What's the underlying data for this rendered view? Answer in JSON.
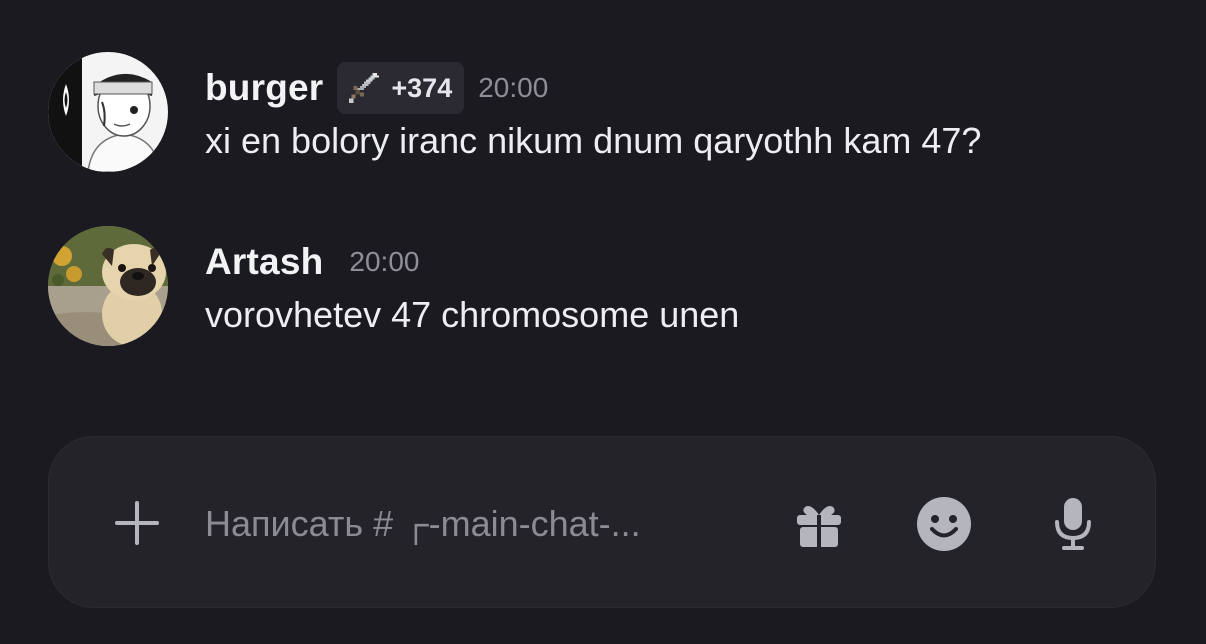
{
  "messages": [
    {
      "username": "burger",
      "badge": "+374",
      "badge_icon": "sword-icon",
      "timestamp": "20:00",
      "text": "xi en bolory iranc nikum dnum qaryothh kam 47?"
    },
    {
      "username": "Artash",
      "timestamp": "20:00",
      "text": "vorovhetev 47 chromosome unen"
    }
  ],
  "composer": {
    "placeholder": "Написать # ┌-main-chat-...",
    "value": "",
    "icons": [
      "plus-icon",
      "gift-icon",
      "emoji-icon",
      "microphone-icon"
    ]
  },
  "colors": {
    "background": "#1b1a20",
    "composer_bg": "#242329",
    "badge_bg": "#2b2a32",
    "timestamp": "#8d8e96",
    "icon": "#b5b6bd"
  }
}
